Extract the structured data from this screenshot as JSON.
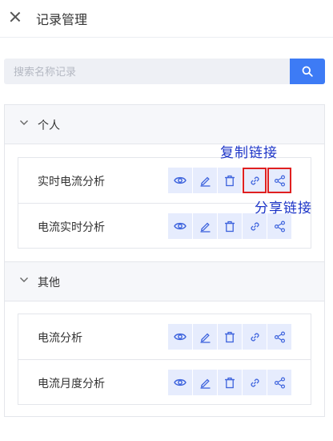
{
  "header": {
    "title": "记录管理",
    "close_icon": "close-icon"
  },
  "search": {
    "placeholder": "搜索名称记录",
    "value": "",
    "button_icon": "search-icon"
  },
  "groups": [
    {
      "label": "个人",
      "expanded": true,
      "items": [
        {
          "label": "实时电流分析"
        },
        {
          "label": "电流实时分析"
        }
      ]
    },
    {
      "label": "其他",
      "expanded": true,
      "items": [
        {
          "label": "电流分析"
        },
        {
          "label": "电流月度分析"
        }
      ]
    }
  ],
  "actions": [
    "view-icon",
    "edit-icon",
    "delete-icon",
    "link-icon",
    "share-icon"
  ],
  "annotations": {
    "copy_link": "复制链接",
    "share_link": "分享链接",
    "highlight_color": "#e02020",
    "text_color": "#1d35c8"
  },
  "colors": {
    "accent": "#3d7bf5",
    "action_bg": "#e6ecfd",
    "icon": "#3d63dd"
  }
}
